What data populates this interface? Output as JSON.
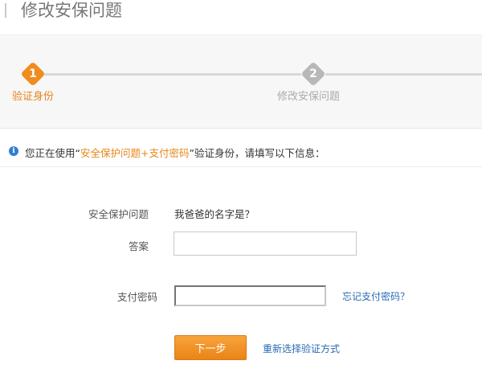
{
  "header": {
    "title": "修改安保问题"
  },
  "steps": [
    {
      "number": "1",
      "label": "验证身份"
    },
    {
      "number": "2",
      "label": "修改安保问题"
    }
  ],
  "notice": {
    "icon": "info-icon",
    "prefix": "您正在使用“",
    "method": "安全保护问题+支付密码",
    "suffix": "”验证身份，请填写以下信息："
  },
  "form": {
    "question_label": "安全保护问题",
    "question_text": "我爸爸的名字是？",
    "answer_label": "答案",
    "answer_value": "",
    "payment_label": "支付密码",
    "payment_value": "",
    "forgot_link": "忘记支付密码？",
    "next_label": "下一步",
    "reselect_link": "重新选择验证方式"
  },
  "colors": {
    "accent": "#f08c1e",
    "link": "#2a6bb5",
    "inactive": "#b8b8b8"
  }
}
